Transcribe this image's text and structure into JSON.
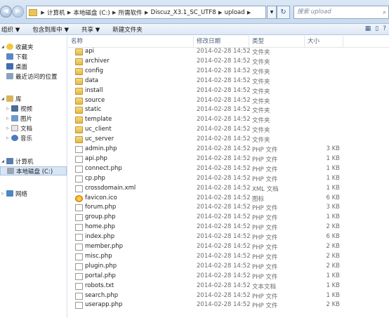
{
  "address": {
    "crumbs": [
      "计算机",
      "本地磁盘 (C:)",
      "所需软件",
      "Discuz_X3.1_SC_UTF8",
      "upload"
    ],
    "search_placeholder": "搜索 upload"
  },
  "toolbar": {
    "organize": "组织 ▼",
    "include_in_library": "包含到库中 ▼",
    "share": "共享 ▼",
    "new_folder": "新建文件夹"
  },
  "nav": {
    "favorites": "收藏夹",
    "downloads": "下载",
    "desktop": "桌面",
    "recent": "最近访问的位置",
    "libraries": "库",
    "videos": "视频",
    "pictures": "图片",
    "documents": "文档",
    "music": "音乐",
    "computer": "计算机",
    "local_disk": "本地磁盘 (C:)",
    "network": "网络"
  },
  "columns": {
    "name": "名称",
    "modified": "修改日期",
    "type": "类型",
    "size": "大小"
  },
  "files": [
    {
      "name": "api",
      "date": "2014-02-28 14:52",
      "type": "文件夹",
      "size": "",
      "icon": "folder"
    },
    {
      "name": "archiver",
      "date": "2014-02-28 14:52",
      "type": "文件夹",
      "size": "",
      "icon": "folder"
    },
    {
      "name": "config",
      "date": "2014-02-28 14:52",
      "type": "文件夹",
      "size": "",
      "icon": "folder"
    },
    {
      "name": "data",
      "date": "2014-02-28 14:52",
      "type": "文件夹",
      "size": "",
      "icon": "folder"
    },
    {
      "name": "install",
      "date": "2014-02-28 14:52",
      "type": "文件夹",
      "size": "",
      "icon": "folder"
    },
    {
      "name": "source",
      "date": "2014-02-28 14:52",
      "type": "文件夹",
      "size": "",
      "icon": "folder"
    },
    {
      "name": "static",
      "date": "2014-02-28 14:52",
      "type": "文件夹",
      "size": "",
      "icon": "folder"
    },
    {
      "name": "template",
      "date": "2014-02-28 14:52",
      "type": "文件夹",
      "size": "",
      "icon": "folder"
    },
    {
      "name": "uc_client",
      "date": "2014-02-28 14:52",
      "type": "文件夹",
      "size": "",
      "icon": "folder"
    },
    {
      "name": "uc_server",
      "date": "2014-02-28 14:52",
      "type": "文件夹",
      "size": "",
      "icon": "folder"
    },
    {
      "name": "admin.php",
      "date": "2014-02-28 14:52",
      "type": "PHP 文件",
      "size": "3 KB",
      "icon": "php"
    },
    {
      "name": "api.php",
      "date": "2014-02-28 14:52",
      "type": "PHP 文件",
      "size": "1 KB",
      "icon": "php"
    },
    {
      "name": "connect.php",
      "date": "2014-02-28 14:52",
      "type": "PHP 文件",
      "size": "1 KB",
      "icon": "php"
    },
    {
      "name": "cp.php",
      "date": "2014-02-28 14:52",
      "type": "PHP 文件",
      "size": "1 KB",
      "icon": "php"
    },
    {
      "name": "crossdomain.xml",
      "date": "2014-02-28 14:52",
      "type": "XML 文档",
      "size": "1 KB",
      "icon": "xml"
    },
    {
      "name": "favicon.ico",
      "date": "2014-02-28 14:52",
      "type": "图标",
      "size": "6 KB",
      "icon": "ico"
    },
    {
      "name": "forum.php",
      "date": "2014-02-28 14:52",
      "type": "PHP 文件",
      "size": "3 KB",
      "icon": "php"
    },
    {
      "name": "group.php",
      "date": "2014-02-28 14:52",
      "type": "PHP 文件",
      "size": "1 KB",
      "icon": "php"
    },
    {
      "name": "home.php",
      "date": "2014-02-28 14:52",
      "type": "PHP 文件",
      "size": "2 KB",
      "icon": "php"
    },
    {
      "name": "index.php",
      "date": "2014-02-28 14:52",
      "type": "PHP 文件",
      "size": "6 KB",
      "icon": "php"
    },
    {
      "name": "member.php",
      "date": "2014-02-28 14:52",
      "type": "PHP 文件",
      "size": "2 KB",
      "icon": "php"
    },
    {
      "name": "misc.php",
      "date": "2014-02-28 14:52",
      "type": "PHP 文件",
      "size": "2 KB",
      "icon": "php"
    },
    {
      "name": "plugin.php",
      "date": "2014-02-28 14:52",
      "type": "PHP 文件",
      "size": "2 KB",
      "icon": "php"
    },
    {
      "name": "portal.php",
      "date": "2014-02-28 14:52",
      "type": "PHP 文件",
      "size": "1 KB",
      "icon": "php"
    },
    {
      "name": "robots.txt",
      "date": "2014-02-28 14:52",
      "type": "文本文档",
      "size": "1 KB",
      "icon": "txt"
    },
    {
      "name": "search.php",
      "date": "2014-02-28 14:52",
      "type": "PHP 文件",
      "size": "1 KB",
      "icon": "php"
    },
    {
      "name": "userapp.php",
      "date": "2014-02-28 14:52",
      "type": "PHP 文件",
      "size": "2 KB",
      "icon": "php"
    }
  ]
}
